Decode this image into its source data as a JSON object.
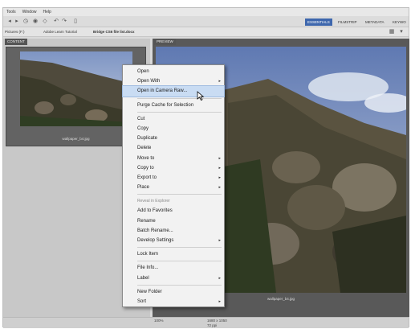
{
  "menubar": {
    "items": [
      "Tools",
      "Window",
      "Help"
    ]
  },
  "toolbar": {
    "workspaces": [
      "ESSENTIALS",
      "FILMSTRIP",
      "METADATA",
      "KEYWO"
    ]
  },
  "pathbar": {
    "crumbs": [
      "Pictures (F:)",
      "Adobe Learn Tutorial",
      "Bridge CS6 file list.docx"
    ]
  },
  "content_panel": {
    "tab": "CONTENT",
    "thumbnail_caption": "wallpaper_b4.jpg"
  },
  "preview_panel": {
    "tab": "PREVIEW",
    "caption": "wallpaper_b4.jpg"
  },
  "context_menu": {
    "items": [
      {
        "label": "Open",
        "submenu": false
      },
      {
        "label": "Open With",
        "submenu": true
      },
      {
        "label": "Open in Camera Raw...",
        "submenu": false,
        "highlighted": true
      },
      {
        "sep": true
      },
      {
        "label": "Purge Cache for Selection",
        "submenu": false
      },
      {
        "sep": true
      },
      {
        "label": "Cut",
        "submenu": false
      },
      {
        "label": "Copy",
        "submenu": false
      },
      {
        "label": "Duplicate",
        "submenu": false
      },
      {
        "label": "Delete",
        "submenu": false
      },
      {
        "label": "Move to",
        "submenu": true
      },
      {
        "label": "Copy to",
        "submenu": true
      },
      {
        "label": "Export to",
        "submenu": true
      },
      {
        "label": "Place",
        "submenu": true
      },
      {
        "sep": true
      },
      {
        "label": "Reveal in Explorer",
        "submenu": false,
        "section": true
      },
      {
        "label": "Add to Favorites",
        "submenu": false
      },
      {
        "label": "Rename",
        "submenu": false
      },
      {
        "label": "Batch Rename...",
        "submenu": false
      },
      {
        "label": "Develop Settings",
        "submenu": true
      },
      {
        "sep": true
      },
      {
        "label": "Lock Item",
        "submenu": false
      },
      {
        "sep": true
      },
      {
        "label": "File Info...",
        "submenu": false
      },
      {
        "label": "Label",
        "submenu": true
      },
      {
        "sep": true
      },
      {
        "label": "New Folder",
        "submenu": false
      },
      {
        "label": "Sort",
        "submenu": true
      }
    ]
  },
  "statusbar": {
    "dimensions": "1680 x 1050",
    "zoom": "100%",
    "ppi": "72 ppi"
  },
  "colors": {
    "accent": "#3e67ad",
    "menu_highlight": "#c9dcf3"
  }
}
